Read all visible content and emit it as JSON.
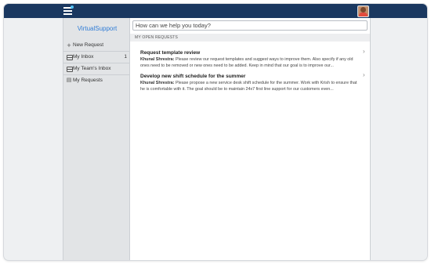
{
  "app": {
    "name": "VirtualSupport"
  },
  "icons": {
    "menu": "hamburger-menu-icon",
    "avatar": "user-avatar"
  },
  "colors": {
    "topbar": "#1a3860",
    "brand": "#2f7cd6",
    "notification_dot": "#4fc3f7"
  },
  "sidebar": {
    "items": [
      {
        "icon": "plus-icon",
        "label": "New Request"
      },
      {
        "icon": "inbox-icon",
        "label": "My Inbox",
        "count": "1"
      },
      {
        "icon": "inbox-icon",
        "label": "My Team's Inbox"
      },
      {
        "icon": "list-icon",
        "label": "My Requests"
      }
    ]
  },
  "search": {
    "placeholder": "How can we help you today?"
  },
  "main": {
    "section_title": "MY OPEN REQUESTS",
    "requests": [
      {
        "title": "Request template review",
        "author": "Khunal Shrestra:",
        "text": "Please review our request templates and suggest ways to improve them. Also specify if any old ones need to be removed or new ones need to be added. Keep in mind that our goal is to improve our..."
      },
      {
        "title": "Develop new shift schedule for the summer",
        "author": "Khunal Shrestra:",
        "text": "Please propose a new service desk shift schedule for the summer. Work with Krish to ensure that he is comfortable with it. The goal should be to maintain 24x7 first line support for our customers even..."
      }
    ]
  }
}
